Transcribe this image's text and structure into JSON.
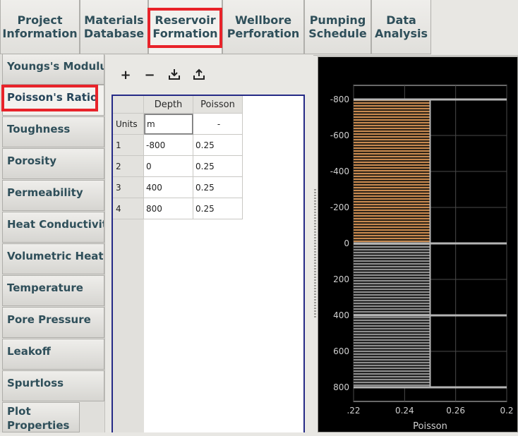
{
  "top_tabs": [
    {
      "label": "Project Information"
    },
    {
      "label": "Materials Database"
    },
    {
      "label": "Reservoir Formation",
      "active": true
    },
    {
      "label": "Wellbore Perforation"
    },
    {
      "label": "Pumping Schedule"
    },
    {
      "label": "Data Analysis"
    }
  ],
  "side_tabs": [
    {
      "label": "Youngs's Modulus"
    },
    {
      "label": "Poisson's Ratio",
      "active": true
    },
    {
      "label": "Toughness"
    },
    {
      "label": "Porosity"
    },
    {
      "label": "Permeability"
    },
    {
      "label": "Heat Conductivity"
    },
    {
      "label": "Volumetric Heat C"
    },
    {
      "label": "Temperature"
    },
    {
      "label": "Pore Pressure"
    },
    {
      "label": "Leakoff"
    },
    {
      "label": "Spurtloss"
    },
    {
      "label": "Plot Properties"
    }
  ],
  "toolbar": {
    "add_icon": "plus-icon",
    "remove_icon": "minus-icon",
    "import_icon": "import-icon",
    "export_icon": "export-icon"
  },
  "table": {
    "columns": [
      "Depth",
      "Poisson"
    ],
    "units_label": "Units",
    "units": [
      "m",
      "-"
    ],
    "rows": [
      {
        "index": "1",
        "depth": "-800",
        "poisson": "0.25"
      },
      {
        "index": "2",
        "depth": "0",
        "poisson": "0.25"
      },
      {
        "index": "3",
        "depth": "400",
        "poisson": "0.25"
      },
      {
        "index": "4",
        "depth": "800",
        "poisson": "0.25"
      }
    ]
  },
  "colors": {
    "highlight": "#e8232a",
    "layer_upper": "#c98a50",
    "layer_lower": "#8e8e8e",
    "chart_bg": "#000000"
  },
  "chart_data": {
    "type": "area",
    "xlabel": "Poisson",
    "ylabel": "",
    "x_tick_labels": [
      ".22",
      "0.24",
      "0.26",
      "0.2"
    ],
    "y_tick_labels": [
      "-800",
      "-600",
      "-400",
      "-200",
      "0",
      "200",
      "400",
      "600",
      "800"
    ],
    "xlim": [
      0.22,
      0.28
    ],
    "ylim": [
      -800,
      800
    ],
    "y_inverted": true,
    "layers": [
      {
        "top": -800,
        "bottom": 0,
        "value": 0.25,
        "color": "#c98a50"
      },
      {
        "top": 0,
        "bottom": 800,
        "value": 0.25,
        "color": "#8e8e8e"
      }
    ],
    "boundaries": [
      -800,
      0,
      400,
      800
    ],
    "grid": true
  }
}
